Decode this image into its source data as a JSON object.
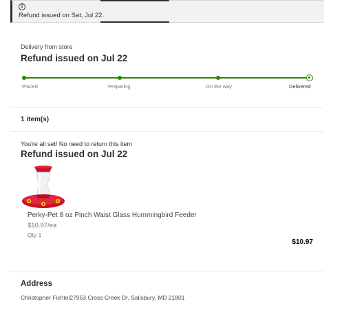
{
  "banner": {
    "icon": "info-icon",
    "message": "Refund issued on Sat, Jul 22."
  },
  "order": {
    "delivery_type": "Delivery from store",
    "status_title": "Refund issued on Jul 22",
    "steps": [
      {
        "label": "Placed"
      },
      {
        "label": "Preparing"
      },
      {
        "label": "On the way"
      },
      {
        "label": "Delivered"
      }
    ],
    "progress": 1.0,
    "accent_color": "#2a8703"
  },
  "items": {
    "count_label": "1 item(s)",
    "note": "You're all set! No need to return this item",
    "refund_title": "Refund issued on Jul 22",
    "list": [
      {
        "name": "Perky-Pet 8 oz Pinch Waist Glass Hummingbird Feeder",
        "unit_price": "$10.97/ea",
        "qty": "Qty 1",
        "total": "$10.97",
        "image_icon": "hummingbird-feeder-image"
      }
    ]
  },
  "address": {
    "title": "Address",
    "line": "Christopher Fichtel27953 Cross Creek Dr, Salisbury, MD 21801"
  }
}
